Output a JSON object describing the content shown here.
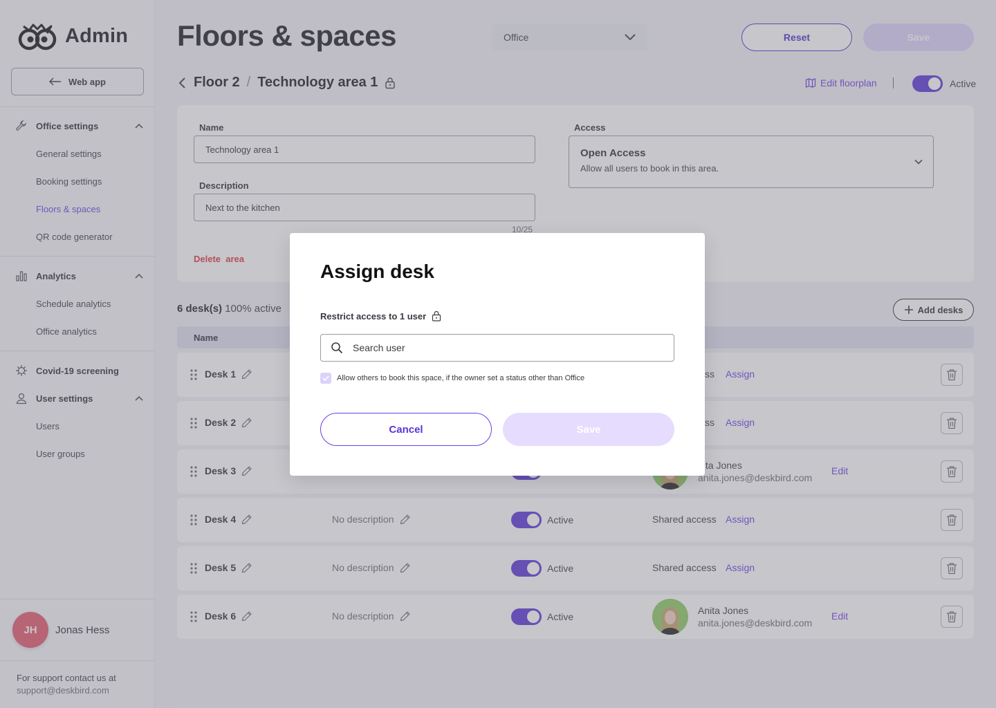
{
  "app": {
    "logo_text": "Admin",
    "web_app_label": "Web app"
  },
  "sidebar": {
    "groups": [
      {
        "label": "Office settings",
        "icon": "wrench-icon",
        "items": [
          "General settings",
          "Booking settings",
          "Floors & spaces",
          "QR code generator"
        ],
        "active_item": "Floors & spaces"
      },
      {
        "label": "Analytics",
        "icon": "bar-chart-icon",
        "items": [
          "Schedule analytics",
          "Office analytics"
        ]
      },
      {
        "label": "Covid-19 screening",
        "icon": "virus-icon",
        "items": []
      },
      {
        "label": "User settings",
        "icon": "user-icon",
        "items": [
          "Users",
          "User groups"
        ]
      }
    ],
    "user": {
      "initials": "JH",
      "name": "Jonas Hess"
    },
    "support": {
      "text": "For support contact us at",
      "email": "support@deskbird.com"
    }
  },
  "header": {
    "title": "Floors & spaces",
    "office_select": "Office",
    "reset_label": "Reset",
    "save_label": "Save"
  },
  "breadcrumb": {
    "floor": "Floor 2",
    "separator": "/",
    "area": "Technology area 1",
    "edit_floorplan": "Edit floorplan",
    "status_label": "Active"
  },
  "area_form": {
    "name_label": "Name",
    "name_value": "Technology area 1",
    "description_label": "Description",
    "description_value": "Next to the kitchen",
    "counter": "10/25",
    "delete_label": "Delete  area",
    "access_label": "Access",
    "access_title": "Open Access",
    "access_desc": "Allow all users to book in this area."
  },
  "desks": {
    "count_bold": "6 desk(s)",
    "count_rest": " 100% active",
    "add_label": "Add desks",
    "column_name": "Name",
    "rows": [
      {
        "name": "Desk 1",
        "access": "ss",
        "action": "Assign"
      },
      {
        "name": "Desk 2",
        "access": "ss",
        "action": "Assign"
      },
      {
        "name": "Desk 3",
        "person_name": "nita Jones",
        "person_email": "anita.jones@deskbird.com",
        "action": "Edit"
      },
      {
        "name": "Desk 4",
        "description": "No description",
        "status": "Active",
        "access": "Shared access",
        "action": "Assign"
      },
      {
        "name": "Desk 5",
        "description": "No description",
        "status": "Active",
        "access": "Shared access",
        "action": "Assign"
      },
      {
        "name": "Desk 6",
        "description": "No description",
        "status": "Active",
        "person_name": "Anita Jones",
        "person_email": "anita.jones@deskbird.com",
        "action": "Edit"
      }
    ]
  },
  "modal": {
    "title": "Assign desk",
    "restrict_label": "Restrict access to 1 user",
    "search_placeholder": "Search user",
    "checkbox_label": "Allow others to book this space, if the owner set a status other than Office",
    "cancel_label": "Cancel",
    "save_label": "Save"
  },
  "colors": {
    "accent": "#6b3fe3",
    "danger": "#e0333f",
    "avatar": "#e5566a"
  }
}
